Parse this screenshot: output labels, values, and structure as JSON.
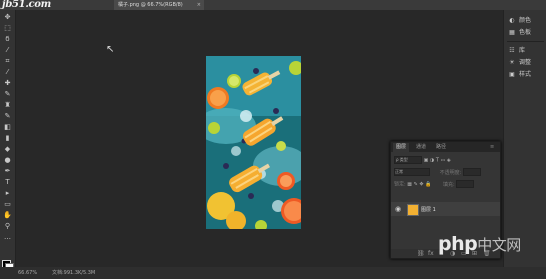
{
  "titlebar": {
    "logo": "jb51.com",
    "doc_tab": "橘子.png @ 66.7%(RGB/8)",
    "close": "×"
  },
  "tools": [
    {
      "icon": "move-icon",
      "glyph": "✥"
    },
    {
      "icon": "marquee-icon",
      "glyph": "⬚"
    },
    {
      "icon": "lasso-icon",
      "glyph": "ϭ"
    },
    {
      "icon": "magic-wand-icon",
      "glyph": "⁄"
    },
    {
      "icon": "crop-icon",
      "glyph": "⌗"
    },
    {
      "icon": "eyedropper-icon",
      "glyph": "⁄"
    },
    {
      "icon": "healing-icon",
      "glyph": "✚"
    },
    {
      "icon": "brush-icon",
      "glyph": "✎"
    },
    {
      "icon": "stamp-icon",
      "glyph": "♜"
    },
    {
      "icon": "history-brush-icon",
      "glyph": "✎"
    },
    {
      "icon": "eraser-icon",
      "glyph": "◧"
    },
    {
      "icon": "gradient-icon",
      "glyph": "▮"
    },
    {
      "icon": "blur-icon",
      "glyph": "◆"
    },
    {
      "icon": "dodge-icon",
      "glyph": "●"
    },
    {
      "icon": "pen-icon",
      "glyph": "✒"
    },
    {
      "icon": "type-icon",
      "glyph": "T"
    },
    {
      "icon": "path-select-icon",
      "glyph": "▸"
    },
    {
      "icon": "shape-icon",
      "glyph": "▭"
    },
    {
      "icon": "hand-icon",
      "glyph": "✋"
    },
    {
      "icon": "zoom-icon",
      "glyph": "⚲"
    },
    {
      "icon": "more-icon",
      "glyph": "…"
    }
  ],
  "right_strip": [
    {
      "icon": "color-icon",
      "glyph": "◐",
      "label": "颜色"
    },
    {
      "icon": "swatches-icon",
      "glyph": "▦",
      "label": "色板"
    },
    {
      "icon": "libraries-icon",
      "glyph": "☷",
      "label": "库"
    },
    {
      "icon": "adjustments-icon",
      "glyph": "☀",
      "label": "调整"
    },
    {
      "icon": "styles-icon",
      "glyph": "▣",
      "label": "样式"
    }
  ],
  "layers_panel": {
    "tabs": [
      "图层",
      "通道",
      "路径"
    ],
    "kind_filter": "ρ 类型",
    "blend_mode": "正常",
    "opacity_label": "不透明度:",
    "lock_label": "锁定:",
    "fill_label": "填充:",
    "layer_name": "图层 1",
    "footer_icons": [
      "link-icon",
      "fx-icon",
      "mask-icon",
      "adjustment-layer-icon",
      "group-icon",
      "new-layer-icon",
      "trash-icon"
    ]
  },
  "statusbar": {
    "zoom": "66.67%",
    "doc_info": "文档:991.3K/5.3M"
  },
  "watermark": {
    "text": "php",
    "suffix": "中文网"
  }
}
